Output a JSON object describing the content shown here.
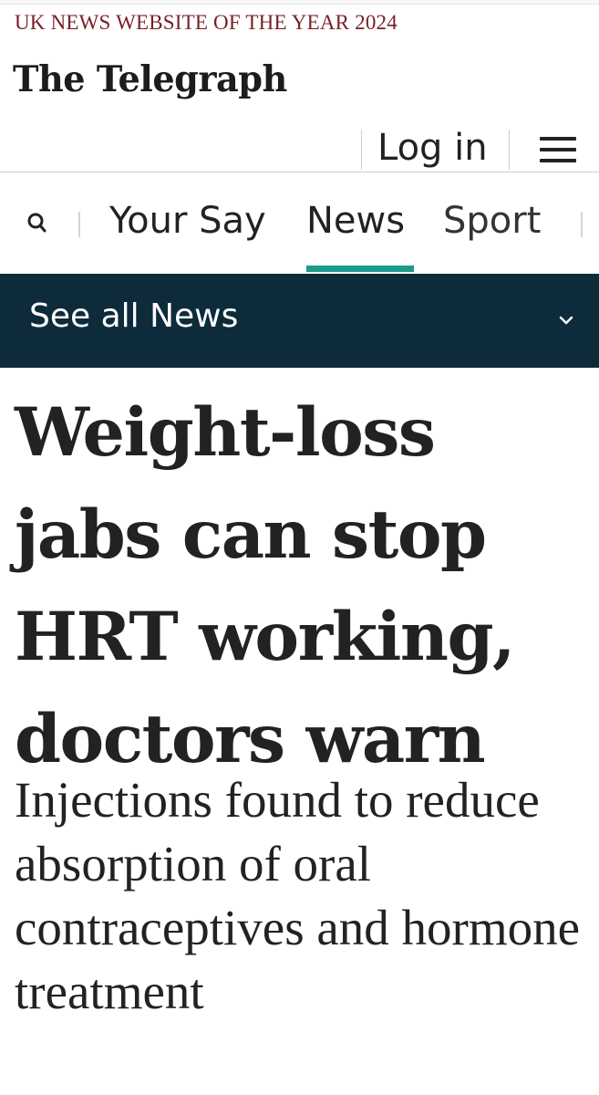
{
  "masthead": {
    "award": "UK NEWS WEBSITE OF THE YEAR 2024",
    "brand": "The Telegraph"
  },
  "account": {
    "login_label": "Log in",
    "menu_icon": "hamburger-menu-icon"
  },
  "nav": {
    "search_icon": "search-icon",
    "items": [
      {
        "label": "Your Say",
        "active": false
      },
      {
        "label": "News",
        "active": true
      },
      {
        "label": "Sport",
        "active": false
      }
    ],
    "accent_color": "#1b9a8b"
  },
  "section_bar": {
    "label": "See all News",
    "icon": "chevron-down-icon",
    "background": "#0e2b3b"
  },
  "article": {
    "headline": "Weight-loss jabs can stop HRT working, doctors warn",
    "standfirst": "Injections found to reduce absorption of oral contraceptives and hormone treatment"
  }
}
